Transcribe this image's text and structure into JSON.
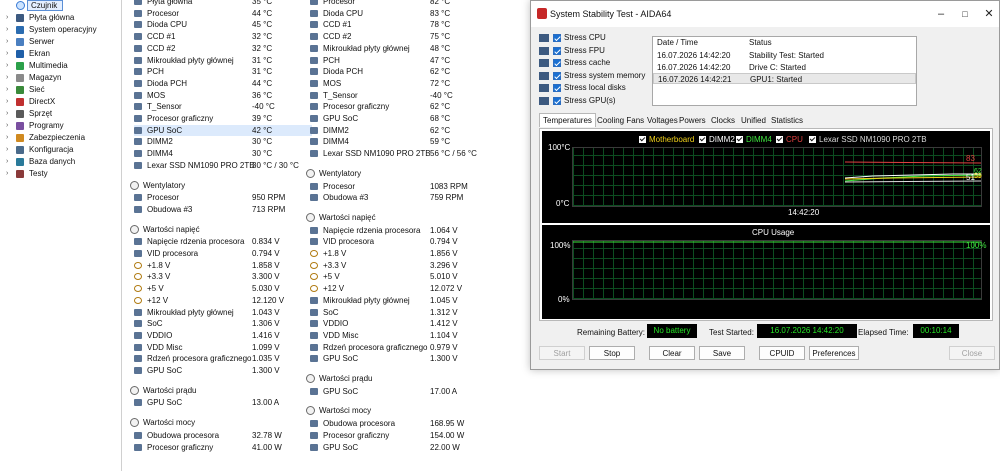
{
  "tree": {
    "selected": "Czujnik",
    "items": [
      "Płyta główna",
      "System operacyjny",
      "Serwer",
      "Ekran",
      "Multimedia",
      "Magazyn",
      "Sieć",
      "DirectX",
      "Sprzęt",
      "Programy",
      "Zabezpieczenia",
      "Konfiguracja",
      "Baza danych",
      "Testy"
    ]
  },
  "panel1": {
    "rows": [
      {
        "l": "Płyta główna",
        "v": "35 °C",
        "ic": "ico-chip"
      },
      {
        "l": "Procesor",
        "v": "44 °C",
        "ic": "ico-chip"
      },
      {
        "l": "Dioda CPU",
        "v": "45 °C",
        "ic": "ico-chip"
      },
      {
        "l": "CCD #1",
        "v": "32 °C",
        "ic": "ico-chip"
      },
      {
        "l": "CCD #2",
        "v": "32 °C",
        "ic": "ico-chip"
      },
      {
        "l": "Mikroukład płyty głównej",
        "v": "31 °C",
        "ic": "ico-chip"
      },
      {
        "l": "PCH",
        "v": "31 °C",
        "ic": "ico-chip"
      },
      {
        "l": "Dioda PCH",
        "v": "44 °C",
        "ic": "ico-chip"
      },
      {
        "l": "MOS",
        "v": "36 °C",
        "ic": "ico-mos"
      },
      {
        "l": "T_Sensor",
        "v": "-40 °C",
        "ic": "ico-temp"
      },
      {
        "l": "Procesor graficzny",
        "v": "39 °C",
        "ic": "ico-chip"
      },
      {
        "l": "GPU SoC",
        "v": "42 °C",
        "ic": "ico-chip",
        "sel": true
      },
      {
        "l": "DIMM2",
        "v": "30 °C",
        "ic": "ico-chip"
      },
      {
        "l": "DIMM4",
        "v": "30 °C",
        "ic": "ico-chip"
      },
      {
        "l": "Lexar SSD NM1090 PRO 2TB",
        "v": "30 °C / 30 °C",
        "ic": "ico-drive"
      }
    ],
    "sec_fans": "Wentylatory",
    "fans": [
      {
        "l": "Procesor",
        "v": "950 RPM",
        "ic": "ico-chip"
      },
      {
        "l": "Obudowa #3",
        "v": "713 RPM",
        "ic": "ico-drive"
      }
    ],
    "sec_volt": "Wartości napięć",
    "volts": [
      {
        "l": "Napięcie rdzenia procesora",
        "v": "0.834 V",
        "ic": "ico-chip"
      },
      {
        "l": "VID procesora",
        "v": "0.794 V",
        "ic": "ico-chip"
      },
      {
        "l": "+1.8 V",
        "v": "1.858 V",
        "ic": "ico-volt"
      },
      {
        "l": "+3.3 V",
        "v": "3.300 V",
        "ic": "ico-volt"
      },
      {
        "l": "+5 V",
        "v": "5.030 V",
        "ic": "ico-volt"
      },
      {
        "l": "+12 V",
        "v": "12.120 V",
        "ic": "ico-volt"
      },
      {
        "l": "Mikroukład płyty głównej",
        "v": "1.043 V",
        "ic": "ico-chip"
      },
      {
        "l": "SoC",
        "v": "1.306 V",
        "ic": "ico-chip"
      },
      {
        "l": "VDDIO",
        "v": "1.416 V",
        "ic": "ico-chip"
      },
      {
        "l": "VDD Misc",
        "v": "1.099 V",
        "ic": "ico-chip"
      },
      {
        "l": "Rdzeń procesora graficznego",
        "v": "1.035 V",
        "ic": "ico-chip"
      },
      {
        "l": "GPU SoC",
        "v": "1.300 V",
        "ic": "ico-chip"
      }
    ],
    "sec_curr": "Wartości prądu",
    "curr": [
      {
        "l": "GPU SoC",
        "v": "13.00 A",
        "ic": "ico-chip"
      }
    ],
    "sec_pow": "Wartości mocy",
    "pow": [
      {
        "l": "Obudowa procesora",
        "v": "32.78 W",
        "ic": "ico-chip"
      },
      {
        "l": "Procesor graficzny",
        "v": "41.00 W",
        "ic": "ico-chip"
      }
    ]
  },
  "panel2": {
    "rows": [
      {
        "l": "Procesor",
        "v": "82 °C",
        "ic": "ico-chip"
      },
      {
        "l": "Dioda CPU",
        "v": "83 °C",
        "ic": "ico-chip"
      },
      {
        "l": "CCD #1",
        "v": "78 °C",
        "ic": "ico-chip"
      },
      {
        "l": "CCD #2",
        "v": "75 °C",
        "ic": "ico-chip"
      },
      {
        "l": "Mikroukład płyty głównej",
        "v": "48 °C",
        "ic": "ico-chip"
      },
      {
        "l": "PCH",
        "v": "47 °C",
        "ic": "ico-chip"
      },
      {
        "l": "Dioda PCH",
        "v": "62 °C",
        "ic": "ico-chip"
      },
      {
        "l": "MOS",
        "v": "72 °C",
        "ic": "ico-mos"
      },
      {
        "l": "T_Sensor",
        "v": "-40 °C",
        "ic": "ico-temp"
      },
      {
        "l": "Procesor graficzny",
        "v": "62 °C",
        "ic": "ico-chip"
      },
      {
        "l": "GPU SoC",
        "v": "68 °C",
        "ic": "ico-chip"
      },
      {
        "l": "DIMM2",
        "v": "62 °C",
        "ic": "ico-chip"
      },
      {
        "l": "DIMM4",
        "v": "59 °C",
        "ic": "ico-chip"
      },
      {
        "l": "Lexar SSD NM1090 PRO 2TB",
        "v": "56 °C / 56 °C",
        "ic": "ico-drive"
      }
    ],
    "sec_fans": "Wentylatory",
    "fans": [
      {
        "l": "Procesor",
        "v": "1083 RPM",
        "ic": "ico-chip"
      },
      {
        "l": "Obudowa #3",
        "v": "759 RPM",
        "ic": "ico-drive"
      }
    ],
    "sec_volt": "Wartości napięć",
    "volts": [
      {
        "l": "Napięcie rdzenia procesora",
        "v": "1.064 V",
        "ic": "ico-chip"
      },
      {
        "l": "VID procesora",
        "v": "0.794 V",
        "ic": "ico-chip"
      },
      {
        "l": "+1.8 V",
        "v": "1.856 V",
        "ic": "ico-volt"
      },
      {
        "l": "+3.3 V",
        "v": "3.296 V",
        "ic": "ico-volt"
      },
      {
        "l": "+5 V",
        "v": "5.010 V",
        "ic": "ico-volt"
      },
      {
        "l": "+12 V",
        "v": "12.072 V",
        "ic": "ico-volt"
      },
      {
        "l": "Mikroukład płyty głównej",
        "v": "1.045 V",
        "ic": "ico-chip"
      },
      {
        "l": "SoC",
        "v": "1.312 V",
        "ic": "ico-chip"
      },
      {
        "l": "VDDIO",
        "v": "1.412 V",
        "ic": "ico-chip"
      },
      {
        "l": "VDD Misc",
        "v": "1.104 V",
        "ic": "ico-chip"
      },
      {
        "l": "Rdzeń procesora graficznego",
        "v": "0.979 V",
        "ic": "ico-chip"
      },
      {
        "l": "GPU SoC",
        "v": "1.300 V",
        "ic": "ico-chip"
      }
    ],
    "sec_curr": "Wartości prądu",
    "curr": [
      {
        "l": "GPU SoC",
        "v": "17.00 A",
        "ic": "ico-chip"
      }
    ],
    "sec_pow": "Wartości mocy",
    "pow": [
      {
        "l": "Obudowa procesora",
        "v": "168.95 W",
        "ic": "ico-chip"
      },
      {
        "l": "Procesor graficzny",
        "v": "154.00 W",
        "ic": "ico-chip"
      },
      {
        "l": "GPU SoC",
        "v": "22.00 W",
        "ic": "ico-chip"
      }
    ]
  },
  "window": {
    "title": "System Stability Test - AIDA64",
    "stress": [
      "Stress CPU",
      "Stress FPU",
      "Stress cache",
      "Stress system memory",
      "Stress local disks",
      "Stress GPU(s)"
    ],
    "log_headers": [
      "Date / Time",
      "Status"
    ],
    "log": [
      {
        "t": "16.07.2026 14:42:20",
        "s": "Stability Test: Started"
      },
      {
        "t": "16.07.2026 14:42:20",
        "s": "Drive C: Started"
      },
      {
        "t": "16.07.2026 14:42:21",
        "s": "GPU1: Started"
      }
    ],
    "tabs": [
      "Temperatures",
      "Cooling Fans",
      "Voltages",
      "Powers",
      "Clocks",
      "Unified",
      "Statistics"
    ],
    "legend": [
      {
        "n": "Motherboard",
        "c": "#f2d21a"
      },
      {
        "n": "DIMM2",
        "c": "#ffffff"
      },
      {
        "n": "DIMM4",
        "c": "#3ee63e"
      },
      {
        "n": "CPU",
        "c": "#e04040"
      },
      {
        "n": "Lexar SSD NM1090 PRO 2TB",
        "c": "#dddddd"
      }
    ],
    "temp_graph": {
      "ymax": "100°C",
      "ymin": "0°C",
      "time": "14:42:20",
      "r1": "83",
      "r2": "62",
      "r3": "59",
      "r4": "51",
      "r5": "56"
    },
    "cpu_graph": {
      "title": "CPU Usage",
      "ymax": "100%",
      "ymin": "0%",
      "right": "100%"
    },
    "battery_label": "Remaining Battery:",
    "battery": "No battery",
    "started_label": "Test Started:",
    "started": "16.07.2026 14:42:20",
    "elapsed_label": "Elapsed Time:",
    "elapsed": "00:10:14",
    "buttons": {
      "start": "Start",
      "stop": "Stop",
      "clear": "Clear",
      "save": "Save",
      "cpuid": "CPUID",
      "prefs": "Preferences",
      "close": "Close"
    }
  }
}
